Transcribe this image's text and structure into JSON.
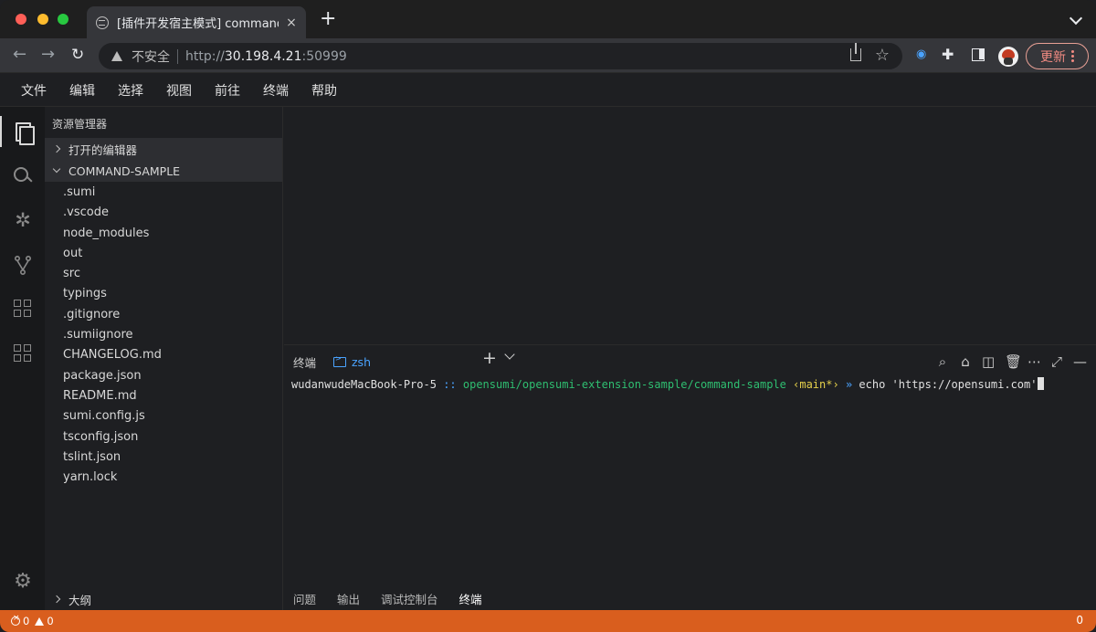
{
  "browser": {
    "tab_title": "[插件开发宿主模式] command-s",
    "tab_close": "×",
    "new_tab": "+",
    "insecure_label": "不安全",
    "url_protocol": "http://",
    "url_host": "30.198.4.21",
    "url_port": ":50999",
    "star": "☆",
    "update_label": "更新",
    "nav_back": "←",
    "nav_forward": "→",
    "nav_reload": "↻",
    "ext_icon": "◉",
    "puzzle_icon": "✚"
  },
  "menubar": {
    "items": [
      "文件",
      "编辑",
      "选择",
      "视图",
      "前往",
      "终端",
      "帮助"
    ]
  },
  "activity": {
    "debug_glyph": "✲",
    "settings_glyph": "⚙"
  },
  "sidebar": {
    "title": "资源管理器",
    "open_editors": "打开的编辑器",
    "project": "COMMAND-SAMPLE",
    "files": [
      ".sumi",
      ".vscode",
      "node_modules",
      "out",
      "src",
      "typings",
      ".gitignore",
      ".sumiignore",
      "CHANGELOG.md",
      "package.json",
      "README.md",
      "sumi.config.js",
      "tsconfig.json",
      "tslint.json",
      "yarn.lock"
    ],
    "outline": "大纲"
  },
  "panel": {
    "title": "终端",
    "terminal_tab": "zsh",
    "add_glyph": "+",
    "action_glyphs": [
      "⌕",
      "⌂",
      "◫",
      "🗑",
      "⋯",
      "⤢",
      "—"
    ],
    "terminal": {
      "host": "wudanwudeMacBook-Pro-5",
      "sep": "::",
      "path": "opensumi/opensumi-extension-sample/command-sample",
      "branch": "‹main*›",
      "arrow": "»",
      "command": "echo 'https://opensumi.com'"
    }
  },
  "bottom_tabs": [
    "问题",
    "输出",
    "调试控制台",
    "终端"
  ],
  "status": {
    "errors": "0",
    "warnings": "0",
    "right": "0"
  },
  "colors": {
    "status_bar": "#d95e1e",
    "accent": "#4aa3ff",
    "path_green": "#2fbf71",
    "branch_yellow": "#e5d04b"
  }
}
